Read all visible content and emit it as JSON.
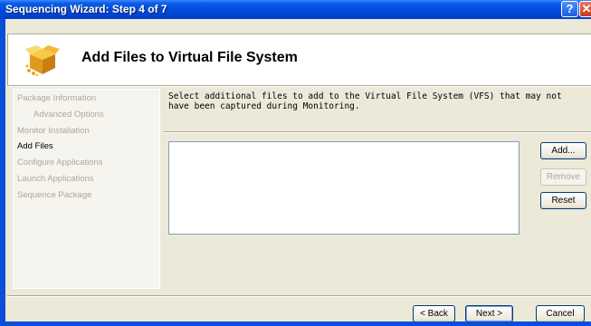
{
  "window": {
    "title": "Sequencing Wizard: Step 4 of 7",
    "help_glyph": "?",
    "close_glyph": "✕"
  },
  "header": {
    "title": "Add Files to Virtual File System",
    "icon": "package-box-icon"
  },
  "nav": {
    "items": [
      {
        "label": "Package Information",
        "state": "disabled"
      },
      {
        "label": "Advanced Options",
        "state": "disabled",
        "sub": true
      },
      {
        "label": "Monitor Installation",
        "state": "disabled"
      },
      {
        "label": "Add Files",
        "state": "active"
      },
      {
        "label": "Configure Applications",
        "state": "disabled"
      },
      {
        "label": "Launch Applications",
        "state": "disabled"
      },
      {
        "label": "Sequence Package",
        "state": "disabled"
      }
    ]
  },
  "content": {
    "description": "Select additional files to add to the Virtual File System (VFS) that may not have been captured during Monitoring.",
    "buttons": {
      "add": "Add...",
      "remove": "Remove",
      "reset": "Reset"
    }
  },
  "footer": {
    "back": "< Back",
    "next": "Next >",
    "cancel": "Cancel"
  },
  "colors": {
    "titlebar": "#0048d8",
    "dialog": "#ece9d8",
    "nav_disabled_text": "#aca899"
  }
}
